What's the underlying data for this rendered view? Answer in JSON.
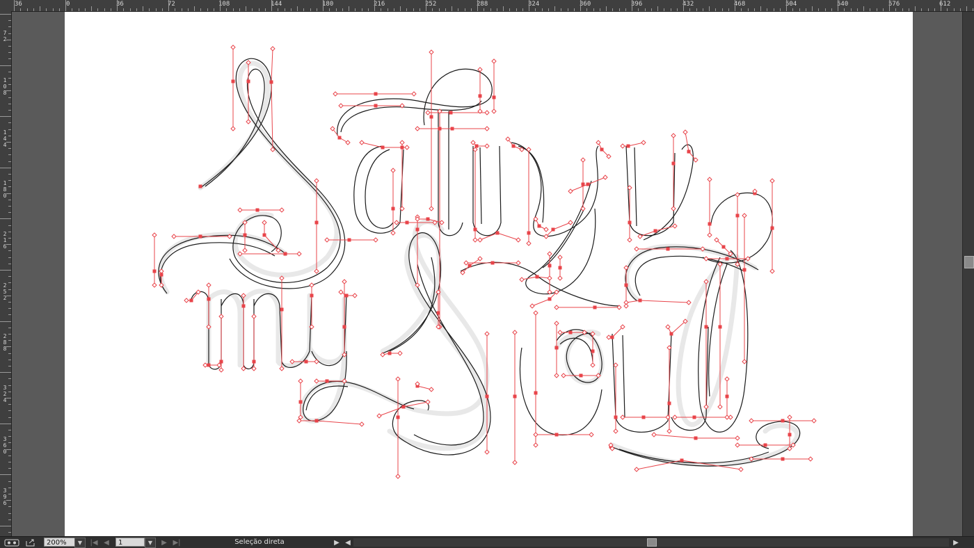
{
  "ruler_top": {
    "labels": [
      "36",
      "0",
      "36",
      "72",
      "108",
      "144",
      "180",
      "216",
      "252",
      "288",
      "324",
      "360",
      "396",
      "432",
      "468",
      "504",
      "540",
      "576",
      "612"
    ]
  },
  "ruler_left": {
    "labels": [
      "72",
      "108",
      "144",
      "180",
      "216",
      "252",
      "288",
      "324",
      "360",
      "396"
    ]
  },
  "status_bar": {
    "zoom_value": "200%",
    "page_value": "1",
    "status_text": "Seleção direta"
  },
  "icons": {
    "preview": "preview-mode-icon",
    "export": "export-icon",
    "first_page": "first-page-icon",
    "prev_page": "prev-page-icon",
    "next_page": "next-page-icon",
    "last_page": "last-page-icon",
    "status_menu": "status-menu-arrow-icon"
  },
  "colors": {
    "anchor_accent": "#e8444a",
    "canvas": "#ffffff",
    "pasteboard": "#535353"
  }
}
